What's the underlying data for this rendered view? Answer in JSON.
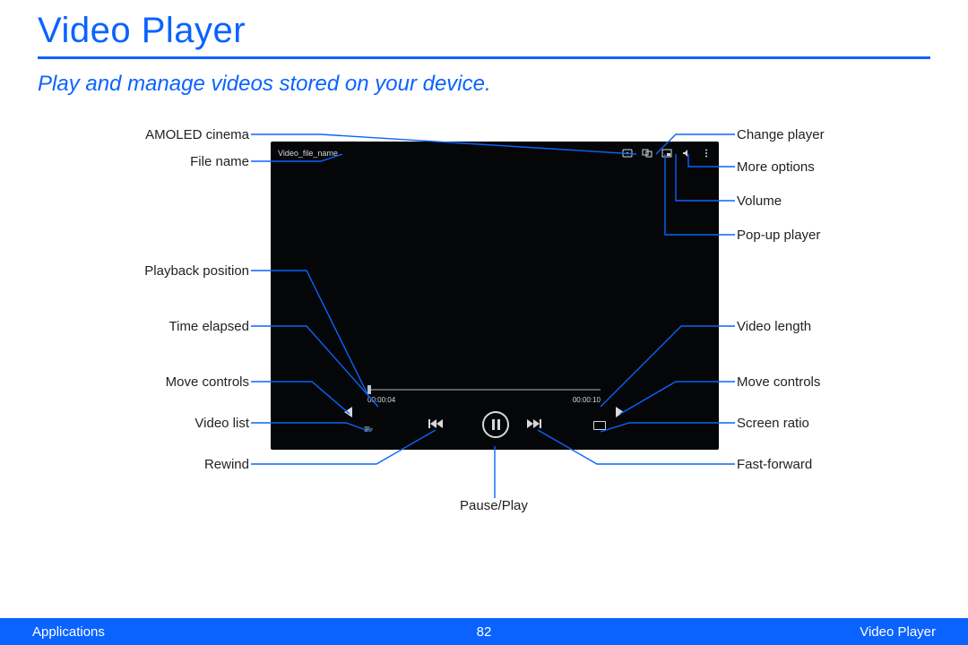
{
  "title": "Video Player",
  "subtitle": "Play and manage videos stored on your device.",
  "footer": {
    "left": "Applications",
    "page": "82",
    "right": "Video Player"
  },
  "player": {
    "file_name": "Video_file_name",
    "time_elapsed": "00:00:04",
    "time_total": "00:00:10"
  },
  "labels": {
    "left": {
      "amoled_cinema": "AMOLED cinema",
      "file_name": "File name",
      "playback_position": "Playback position",
      "time_elapsed": "Time elapsed",
      "move_controls": "Move controls",
      "video_list": "Video list",
      "rewind": "Rewind"
    },
    "right": {
      "change_player": "Change player",
      "more_options": "More options",
      "volume": "Volume",
      "popup_player": "Pop-up player",
      "video_length": "Video length",
      "move_controls": "Move controls",
      "screen_ratio": "Screen ratio",
      "fast_forward": "Fast-forward"
    },
    "bottom": {
      "pause_play": "Pause/Play"
    }
  }
}
